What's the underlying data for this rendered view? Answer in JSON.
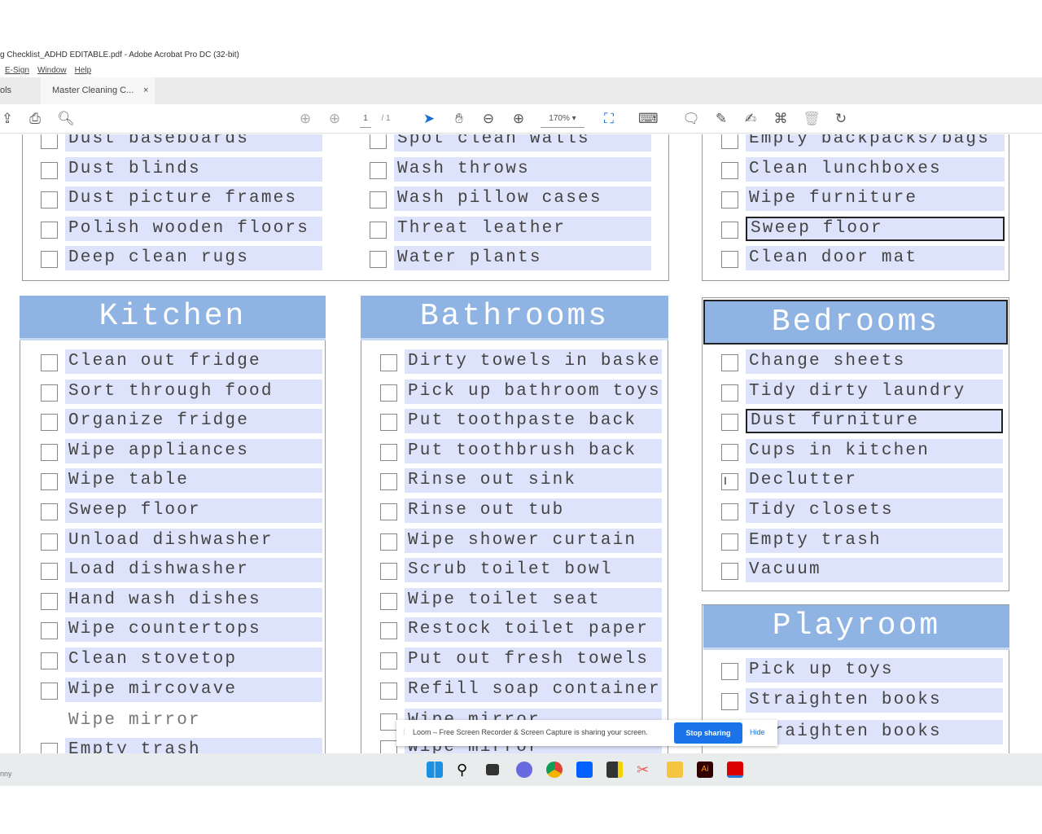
{
  "window": {
    "title": "g Checklist_ADHD EDITABLE.pdf - Adobe Acrobat Pro DC (32-bit)",
    "menu": [
      "E-Sign",
      "Window",
      "Help"
    ]
  },
  "tabs": {
    "tools": "ols",
    "document": "Master Cleaning C...",
    "close": "×"
  },
  "toolbar": {
    "page_current": "1",
    "page_total": "/ 1",
    "zoom": "170%"
  },
  "sections": [
    {
      "id": "top-left-a",
      "items": [
        "Dust baseboards",
        "Dust blinds",
        "Dust picture frames",
        "Polish wooden floors",
        "Deep clean rugs"
      ]
    },
    {
      "id": "top-left-b",
      "items": [
        "Spot clean walls",
        "Wash throws",
        "Wash pillow cases",
        "Threat leather",
        "Water plants"
      ]
    },
    {
      "id": "top-right",
      "items": [
        "Empty backpacks/bags",
        "Clean lunchboxes",
        "Wipe furniture",
        "Sweep floor",
        "Clean door mat"
      ],
      "focused": 3
    },
    {
      "id": "kitchen",
      "title": "Kitchen",
      "items": [
        "Clean out fridge",
        "Sort through food",
        "Organize fridge",
        "Wipe appliances",
        "Wipe table",
        "Sweep floor",
        "Unload dishwasher",
        "Load dishwasher",
        "Hand wash dishes",
        "Wipe countertops",
        "Clean stovetop",
        "Wipe mircovave",
        "Wipe mirror",
        "Empty trash"
      ],
      "overlap_row": "Wipe mircovave"
    },
    {
      "id": "bathrooms",
      "title": "Bathrooms",
      "items": [
        "Dirty towels in basket",
        "Pick up bathroom toys",
        "Put toothpaste back",
        "Put toothbrush back",
        "Rinse out sink",
        "Rinse out tub",
        "Wipe shower curtain",
        "Scrub toilet bowl",
        "Wipe toilet seat",
        "Restock toilet paper",
        "Put out fresh towels",
        "Refill soap containers",
        "Wipe mirror",
        "Wipe mirror"
      ]
    },
    {
      "id": "bedrooms",
      "title": "Bedrooms",
      "items": [
        "Change sheets",
        "Tidy dirty laundry",
        "Dust furniture",
        "Cups in kitchen",
        "Declutter",
        "Tidy closets",
        "Empty trash",
        "Vacuum"
      ],
      "focused": 2
    },
    {
      "id": "playroom",
      "title": "Playroom",
      "items": [
        "Pick up toys",
        "Straighten books",
        "Straighten books"
      ]
    }
  ],
  "loom": {
    "message": "Loom – Free Screen Recorder & Screen Capture is sharing your screen.",
    "stop": "Stop sharing",
    "hide": "Hide"
  },
  "statusbar": {
    "text": "nny"
  },
  "colors": {
    "header": "#8fb4e3",
    "field": "#dde3fa",
    "stop_button": "#1a73e8"
  }
}
